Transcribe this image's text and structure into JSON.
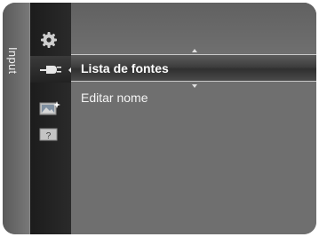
{
  "side_tab": {
    "label": "Input"
  },
  "icons": [
    {
      "name": "settings-gear-icon",
      "active": false
    },
    {
      "name": "input-plug-icon",
      "active": true
    },
    {
      "name": "picture-icon",
      "active": false
    },
    {
      "name": "help-icon",
      "active": false,
      "glyph": "?"
    }
  ],
  "menu": {
    "items": [
      {
        "label": "Lista de fontes",
        "selected": true
      },
      {
        "label": "Editar nome",
        "selected": false
      }
    ]
  }
}
